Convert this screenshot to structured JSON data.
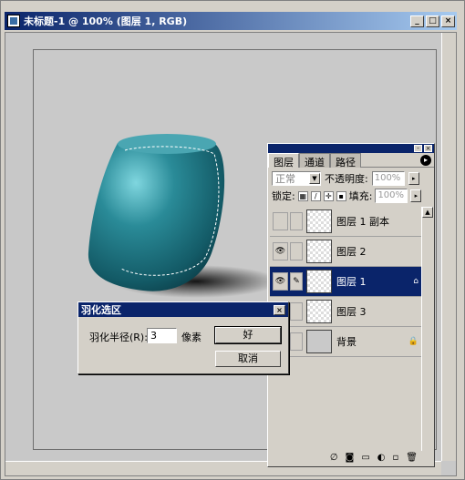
{
  "window": {
    "title": "未标题-1 @ 100% (图层 1, RGB)",
    "min": "_",
    "max": "□",
    "close": "×"
  },
  "layers_panel": {
    "tabs": [
      "图层",
      "通道",
      "路径"
    ],
    "blend_mode": "正常",
    "opacity_label": "不透明度:",
    "opacity_value": "100%",
    "lock_label": "锁定:",
    "fill_label": "填充:",
    "fill_value": "100%",
    "layers": [
      {
        "name": "图层 1 副本",
        "visible": false,
        "selected": false
      },
      {
        "name": "图层 2",
        "visible": true,
        "selected": false
      },
      {
        "name": "图层 1",
        "visible": true,
        "selected": true
      },
      {
        "name": "图层 3",
        "visible": false,
        "selected": false
      },
      {
        "name": "背景",
        "visible": false,
        "selected": false,
        "locked": true
      }
    ]
  },
  "feather_dialog": {
    "title": "羽化选区",
    "radius_label": "羽化半径(R):",
    "radius_value": "3",
    "unit": "像素",
    "ok_label": "好",
    "cancel_label": "取消"
  },
  "colors": {
    "title_bar": "#0a246a",
    "vase": "#2a7f8e",
    "canvas": "#c9c9c9"
  }
}
